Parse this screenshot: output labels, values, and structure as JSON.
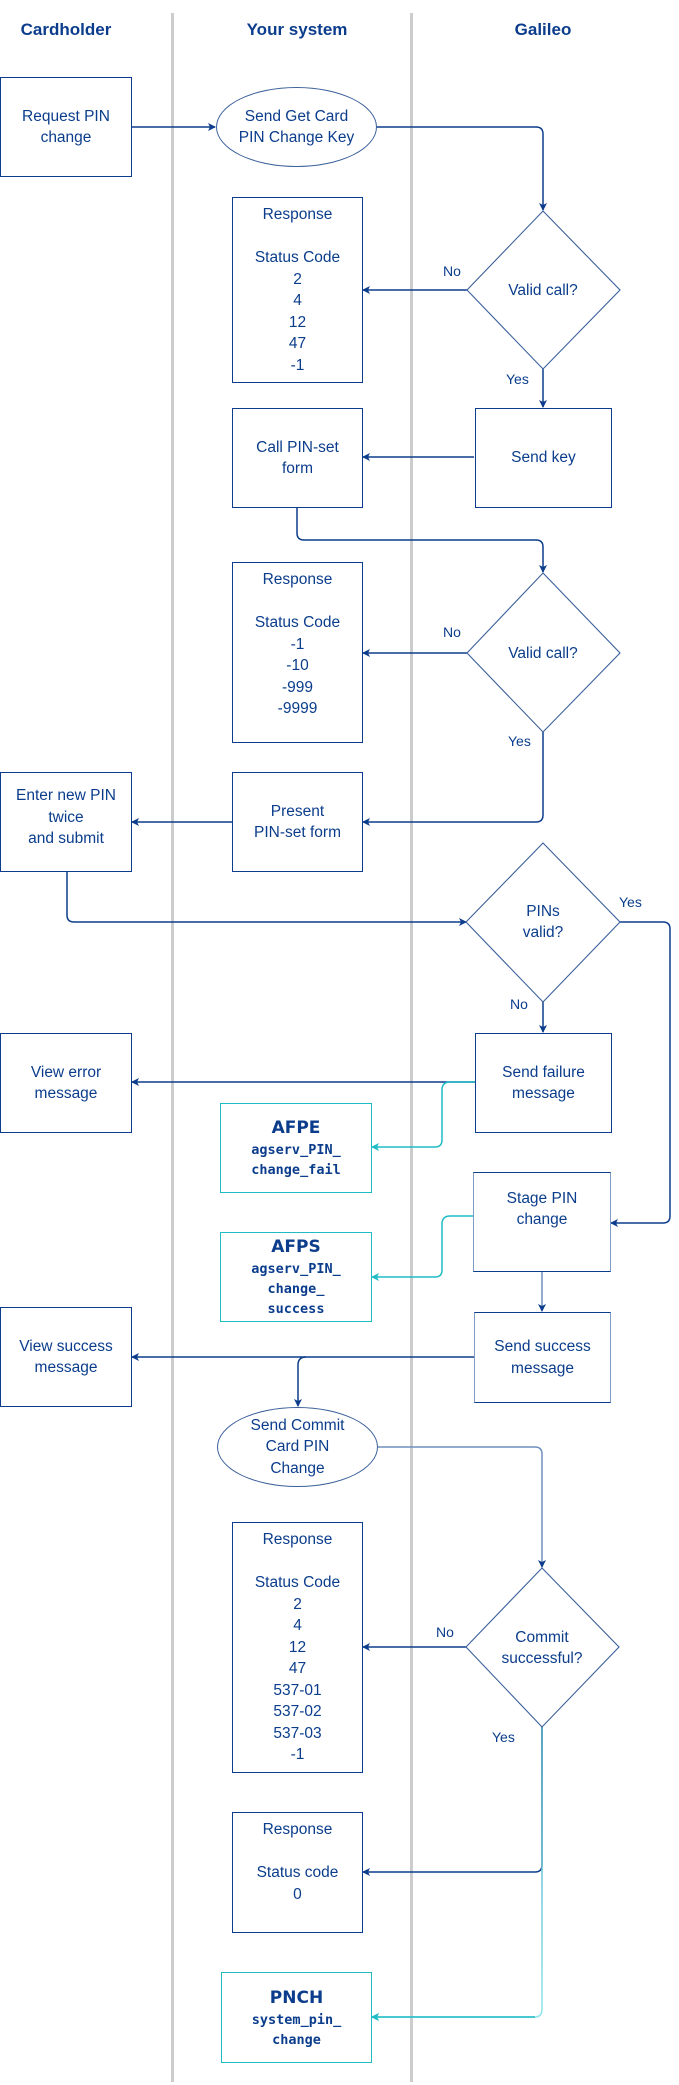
{
  "lanes": [
    {
      "title": "Cardholder"
    },
    {
      "title": "Your system"
    },
    {
      "title": "Galileo"
    }
  ],
  "colors": {
    "primary": "#0b3d8c",
    "event": "#1fbcc6",
    "lane_divider": "#cccccc"
  },
  "nodes": {
    "request_pin_change": {
      "lines": [
        "Request PIN",
        "change"
      ]
    },
    "send_get_card_pin_change_key": {
      "lines": [
        "Send Get Card",
        "PIN Change Key"
      ]
    },
    "response_1": {
      "title": "Response",
      "label": "Status Code",
      "codes": [
        "2",
        "4",
        "12",
        "47",
        "-1"
      ]
    },
    "valid_call_1": {
      "lines": [
        "Valid call?"
      ]
    },
    "send_key": {
      "lines": [
        "Send key"
      ]
    },
    "call_pin_set_form": {
      "lines": [
        "Call PIN-set",
        "form"
      ]
    },
    "response_2": {
      "title": "Response",
      "label": "Status Code",
      "codes": [
        "-1",
        "-10",
        "-999",
        "-9999"
      ]
    },
    "valid_call_2": {
      "lines": [
        "Valid call?"
      ]
    },
    "present_pin_set_form": {
      "lines": [
        "Present",
        "PIN-set form"
      ]
    },
    "enter_new_pin": {
      "lines": [
        "Enter new PIN",
        "twice",
        "and submit"
      ]
    },
    "pins_valid": {
      "lines": [
        "PINs",
        "valid?"
      ]
    },
    "view_error_message": {
      "lines": [
        "View error",
        "message"
      ]
    },
    "send_failure_message": {
      "lines": [
        "Send failure",
        "message"
      ]
    },
    "afpe_event": {
      "code": "AFPE",
      "lines": [
        "agserv_PIN_",
        "change_fail"
      ]
    },
    "stage_pin_change": {
      "lines": [
        "Stage PIN",
        "change"
      ]
    },
    "afps_event": {
      "code": "AFPS",
      "lines": [
        "agserv_PIN_",
        "change_",
        "success"
      ]
    },
    "view_success_message": {
      "lines": [
        "View success",
        "message"
      ]
    },
    "send_success_message": {
      "lines": [
        "Send success",
        "message"
      ]
    },
    "send_commit_card_pin_change": {
      "lines": [
        "Send Commit",
        "Card PIN",
        "Change"
      ]
    },
    "response_3": {
      "title": "Response",
      "label": "Status Code",
      "codes": [
        "2",
        "4",
        "12",
        "47",
        "537-01",
        "537-02",
        "537-03",
        "-1"
      ]
    },
    "commit_successful": {
      "lines": [
        "Commit",
        "successful?"
      ]
    },
    "response_4": {
      "title": "Response",
      "label": "Status code",
      "codes": [
        "0"
      ]
    },
    "pnch_event": {
      "code": "PNCH",
      "lines": [
        "system_pin_",
        "change"
      ]
    }
  },
  "edge_labels": {
    "valid_call_1_no": "No",
    "valid_call_1_yes": "Yes",
    "valid_call_2_no": "No",
    "valid_call_2_yes": "Yes",
    "pins_valid_yes": "Yes",
    "pins_valid_no": "No",
    "commit_no": "No",
    "commit_yes": "Yes"
  }
}
